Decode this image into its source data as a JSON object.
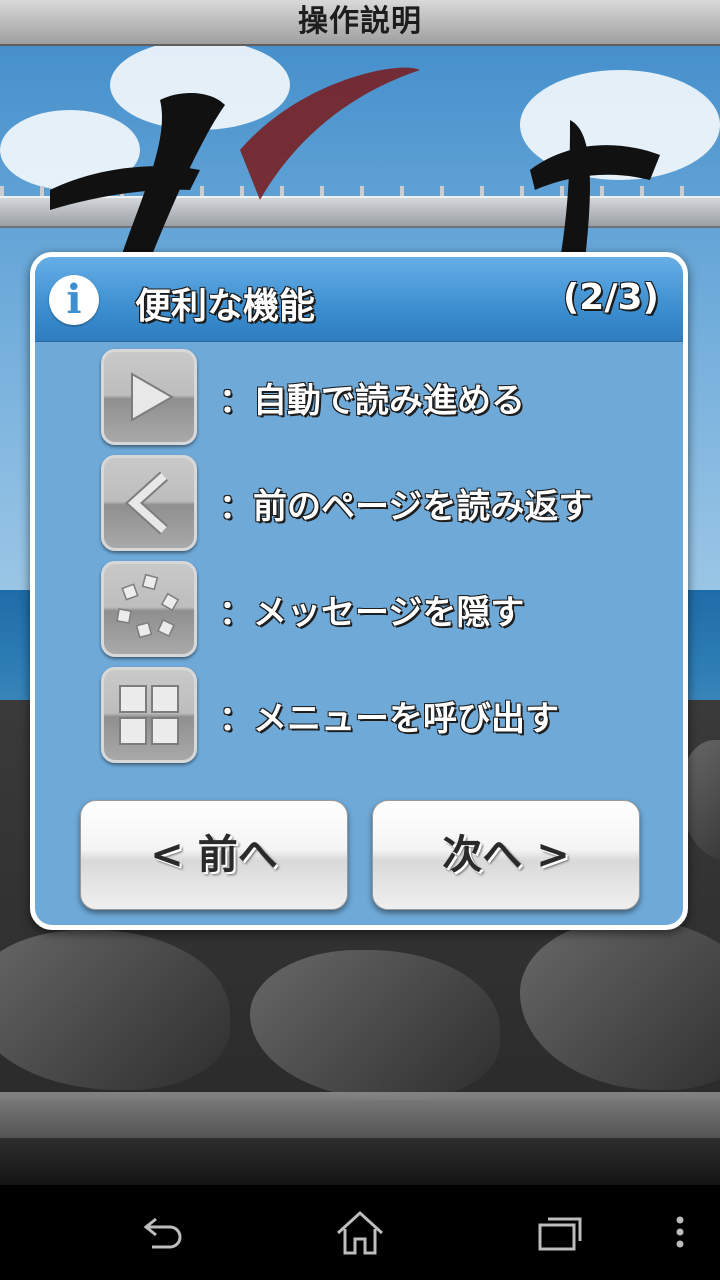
{
  "header": {
    "title": "操作説明"
  },
  "dialog": {
    "title": "便利な機能",
    "page": "(2/3)",
    "features": [
      {
        "icon": "play-icon",
        "label": "：自動で読み進める"
      },
      {
        "icon": "back-chevron-icon",
        "label": "：前のページを読み返す"
      },
      {
        "icon": "hide-message-icon",
        "label": "：メッセージを隠す"
      },
      {
        "icon": "menu-grid-icon",
        "label": "：メニューを呼び出す"
      }
    ],
    "prev_button": "< 前へ",
    "next_button": "次へ >"
  },
  "navbar": {
    "back": "back-icon",
    "home": "home-icon",
    "recents": "recents-icon",
    "menu": "overflow-menu-icon"
  }
}
